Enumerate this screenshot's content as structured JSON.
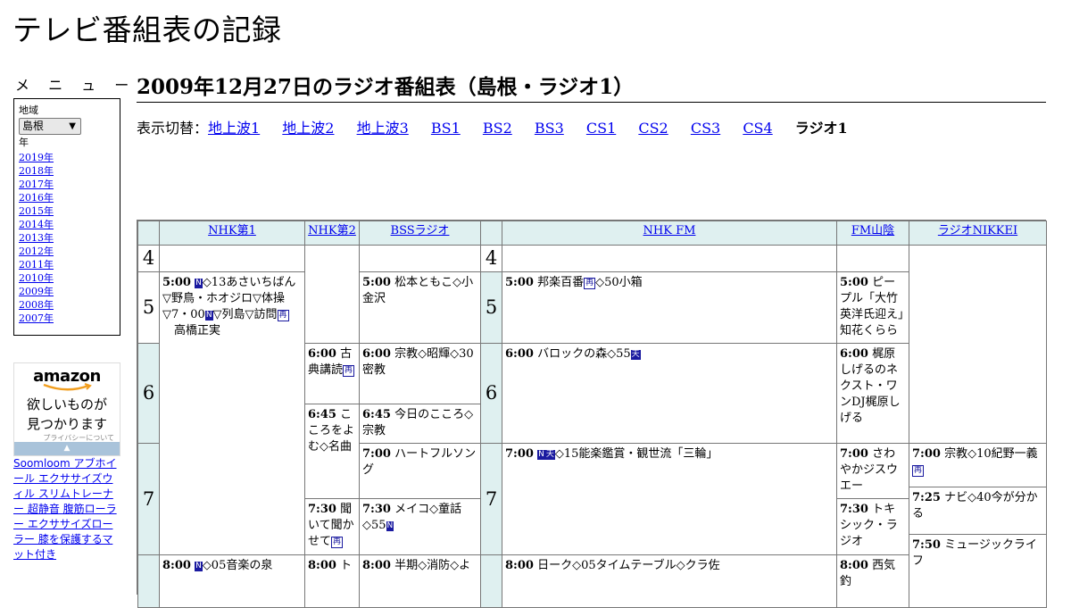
{
  "site": {
    "title": "テレビ番組表の記録"
  },
  "menu": {
    "heading": "メ ニ ュ ー",
    "region_label": "地域",
    "region_value": "島根",
    "year_label": "年",
    "years": [
      "2019年",
      "2018年",
      "2017年",
      "2016年",
      "2015年",
      "2014年",
      "2013年",
      "2012年",
      "2011年",
      "2010年",
      "2009年",
      "2008年",
      "2007年"
    ]
  },
  "ad": {
    "logo": "amazon",
    "text_line1": "欲しいものが",
    "text_line2": "見つかります",
    "privacy": "プライバシーについて"
  },
  "products": {
    "text": "Soomloom アブホイール エクササイズウィル スリムトレーナー 超静音 腹筋ローラー エクササイズローラー 膝を保護するマット付き"
  },
  "page": {
    "heading": "2009年12月27日のラジオ番組表（島根・ラジオ1）",
    "switch_prefix": "表示切替：",
    "tabs": [
      "地上波1",
      "地上波2",
      "地上波3",
      "BS1",
      "BS2",
      "BS3",
      "CS1",
      "CS2",
      "CS3",
      "CS4"
    ],
    "current_tab": "ラジオ1"
  },
  "schedule": {
    "stations": [
      "NHK第1",
      "NHK第2",
      "BSSラジオ",
      "NHK FM",
      "FM山陰",
      "ラジオNIKKEI"
    ],
    "hours": [
      "4",
      "5",
      "6",
      "7"
    ],
    "programs": {
      "nhk1_500": {
        "time": "5:00",
        "pre": "",
        "text": "◇13あさいちばん▽野鳥・ホオジロ▽体操▽7・00",
        "text2": "▽列島▽訪問",
        "text3": "　高橋正実"
      },
      "nhk2_600": {
        "time": "6:00",
        "text": "古典講読"
      },
      "nhk2_645": {
        "time": "6:45",
        "text": "こころをよむ◇名曲"
      },
      "nhk2_730": {
        "time": "7:30",
        "text": "聞いて聞かせて"
      },
      "bss_500": {
        "time": "5:00",
        "text": "松本ともこ◇小金沢"
      },
      "bss_600": {
        "time": "6:00",
        "text": "宗教◇昭輝◇30密教"
      },
      "bss_645": {
        "time": "6:45",
        "text": "今日のこころ◇宗教"
      },
      "bss_700": {
        "time": "7:00",
        "text": "ハートフルソング"
      },
      "bss_730": {
        "time": "7:30",
        "text": "メイコ◇童話◇55"
      },
      "fm_500": {
        "time": "5:00",
        "text": "邦楽百番",
        "text2": "◇50小箱"
      },
      "fm_600": {
        "time": "6:00",
        "text": "バロックの森◇55"
      },
      "fm_700": {
        "time": "7:00",
        "text": "◇15能楽鑑賞・観世流「三輪」"
      },
      "fms_500": {
        "time": "5:00",
        "text": "ピープル「大竹英洋氏迎え」知花くらら"
      },
      "fms_600": {
        "time": "6:00",
        "text": "梶原しげるのネクスト・ワンDJ梶原しげる"
      },
      "fms_700": {
        "time": "7:00",
        "text": "さわやかジスウエー"
      },
      "fms_730": {
        "time": "7:30",
        "text": "トキシック・ラジオ"
      },
      "nk_700": {
        "time": "7:00",
        "text": "宗教◇10紀野一義"
      },
      "nk_725": {
        "time": "7:25",
        "text": "ナビ◇40今が分かる"
      },
      "nk_750": {
        "time": "7:50",
        "text": "ミュージックライフ"
      },
      "nhk1_800": {
        "time": "8:00",
        "text": "◇05音楽の泉"
      },
      "nhk2_800": {
        "time": "8:00",
        "text": "ト"
      },
      "bss_800": {
        "time": "8:00",
        "text": "半期◇消防◇よ"
      },
      "fm_800": {
        "time": "8:00",
        "text": "日ーク◇05タイムテーブル◇クラ佐"
      },
      "fms_800": {
        "time": "8:00",
        "text": "西気釣"
      }
    },
    "badges": {
      "news": "N",
      "rerun": "再",
      "stereo": "天"
    }
  },
  "colors": {
    "header_bg": "#dff0f0",
    "link": "#0000ee",
    "badge": "#1a1aa0"
  }
}
